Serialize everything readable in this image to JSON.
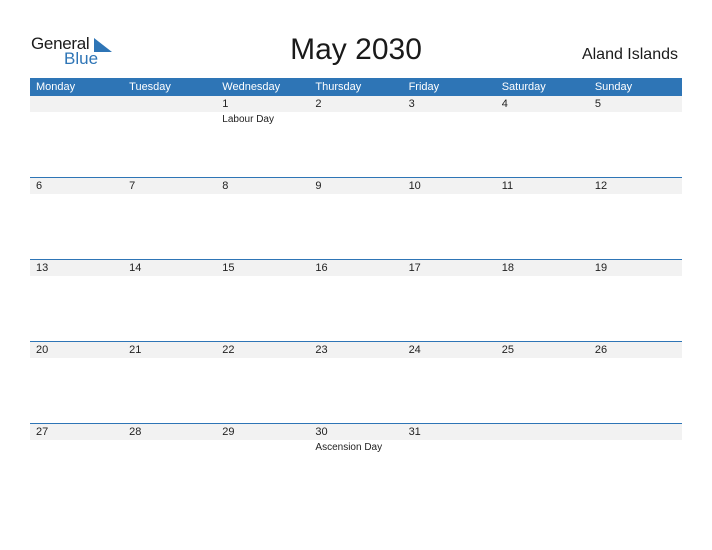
{
  "logo": {
    "word1": "General",
    "word2": "Blue"
  },
  "title": "May 2030",
  "country": "Aland Islands",
  "weekdays": [
    "Monday",
    "Tuesday",
    "Wednesday",
    "Thursday",
    "Friday",
    "Saturday",
    "Sunday"
  ],
  "weeks": [
    {
      "days": [
        "",
        "",
        "1",
        "2",
        "3",
        "4",
        "5"
      ],
      "events": [
        "",
        "",
        "Labour Day",
        "",
        "",
        "",
        ""
      ]
    },
    {
      "days": [
        "6",
        "7",
        "8",
        "9",
        "10",
        "11",
        "12"
      ],
      "events": [
        "",
        "",
        "",
        "",
        "",
        "",
        ""
      ]
    },
    {
      "days": [
        "13",
        "14",
        "15",
        "16",
        "17",
        "18",
        "19"
      ],
      "events": [
        "",
        "",
        "",
        "",
        "",
        "",
        ""
      ]
    },
    {
      "days": [
        "20",
        "21",
        "22",
        "23",
        "24",
        "25",
        "26"
      ],
      "events": [
        "",
        "",
        "",
        "",
        "",
        "",
        ""
      ]
    },
    {
      "days": [
        "27",
        "28",
        "29",
        "30",
        "31",
        "",
        ""
      ],
      "events": [
        "",
        "",
        "",
        "Ascension Day",
        "",
        "",
        ""
      ]
    }
  ],
  "colors": {
    "accent": "#2e75b6",
    "strip": "#f2f2f2"
  }
}
